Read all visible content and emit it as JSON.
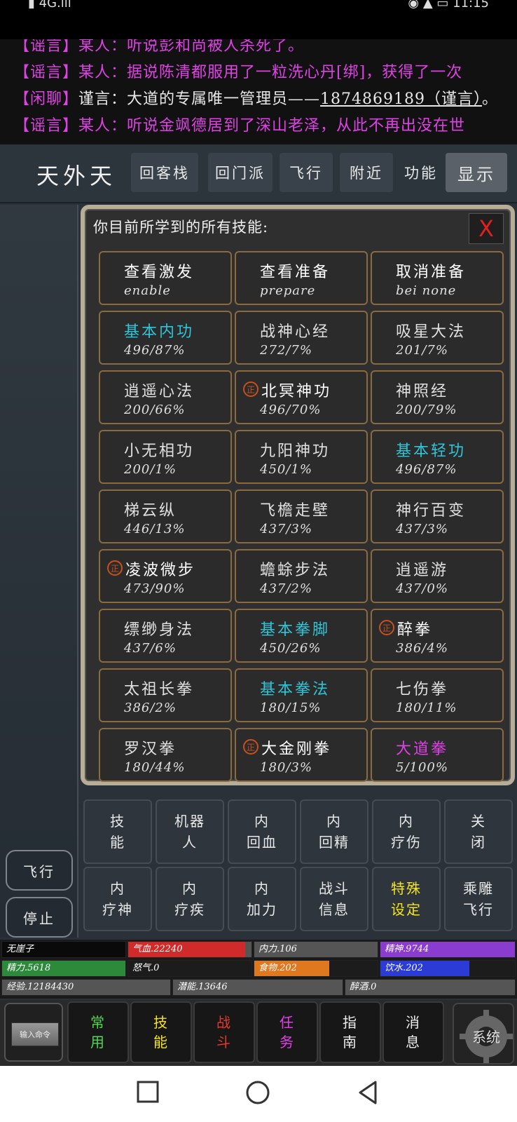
{
  "status_bar": {
    "left": "▮ 4G.ıll",
    "right": "◉ ▲ ▭ 11:15"
  },
  "chat": [
    {
      "tag": "【谣言】",
      "text": "某人：听说彭和尚被人杀死了。",
      "kind": "rumor"
    },
    {
      "tag": "【谣言】",
      "text": "某人：据说陈清都服用了一粒洗心丹[绑]，获得了一次",
      "kind": "rumor"
    },
    {
      "tag": "【闲聊】",
      "text": "谨言：大道的专属唯一管理员——",
      "link": "1874869189（谨言）",
      "end": "。",
      "kind": "chat"
    },
    {
      "tag": "【谣言】",
      "text": "某人：听说金飒德居到了深山老泽，从此不再出没在世",
      "kind": "rumor"
    }
  ],
  "location": {
    "title": "天外天",
    "buttons": [
      "回客栈",
      "回门派",
      "飞行",
      "附近",
      "功能",
      "显示"
    ]
  },
  "side_buttons": {
    "fly": "飞行",
    "stop": "停止"
  },
  "dialog": {
    "title": "你目前所学到的所有技能:",
    "close": "X",
    "cells": [
      {
        "name": "查看激发",
        "sub": "enable",
        "color": "white",
        "badge": ""
      },
      {
        "name": "查看准备",
        "sub": "prepare",
        "color": "white",
        "badge": ""
      },
      {
        "name": "取消准备",
        "sub": "bei none",
        "color": "white",
        "badge": ""
      },
      {
        "name": "基本内功",
        "sub": "496/87%",
        "color": "cyan",
        "badge": ""
      },
      {
        "name": "战神心经",
        "sub": "272/7%",
        "color": "default",
        "badge": ""
      },
      {
        "name": "吸星大法",
        "sub": "201/7%",
        "color": "default",
        "badge": ""
      },
      {
        "name": "逍遥心法",
        "sub": "200/66%",
        "color": "default",
        "badge": ""
      },
      {
        "name": "北冥神功",
        "sub": "496/70%",
        "color": "white",
        "badge": "正"
      },
      {
        "name": "神照经",
        "sub": "200/79%",
        "color": "default",
        "badge": ""
      },
      {
        "name": "小无相功",
        "sub": "200/1%",
        "color": "default",
        "badge": ""
      },
      {
        "name": "九阳神功",
        "sub": "450/1%",
        "color": "default",
        "badge": ""
      },
      {
        "name": "基本轻功",
        "sub": "496/87%",
        "color": "cyan",
        "badge": ""
      },
      {
        "name": "梯云纵",
        "sub": "446/13%",
        "color": "default",
        "badge": ""
      },
      {
        "name": "飞檐走壁",
        "sub": "437/3%",
        "color": "default",
        "badge": ""
      },
      {
        "name": "神行百变",
        "sub": "437/3%",
        "color": "default",
        "badge": ""
      },
      {
        "name": "凌波微步",
        "sub": "473/90%",
        "color": "white",
        "badge": "正"
      },
      {
        "name": "蟾蜍步法",
        "sub": "437/2%",
        "color": "default",
        "badge": ""
      },
      {
        "name": "逍遥游",
        "sub": "437/0%",
        "color": "default",
        "badge": ""
      },
      {
        "name": "缥缈身法",
        "sub": "437/6%",
        "color": "default",
        "badge": ""
      },
      {
        "name": "基本拳脚",
        "sub": "450/26%",
        "color": "cyan",
        "badge": ""
      },
      {
        "name": "醉拳",
        "sub": "386/4%",
        "color": "white",
        "badge": "正"
      },
      {
        "name": "太祖长拳",
        "sub": "386/2%",
        "color": "default",
        "badge": ""
      },
      {
        "name": "基本拳法",
        "sub": "180/15%",
        "color": "cyan",
        "badge": ""
      },
      {
        "name": "七伤拳",
        "sub": "180/11%",
        "color": "default",
        "badge": ""
      },
      {
        "name": "罗汉拳",
        "sub": "180/44%",
        "color": "default",
        "badge": ""
      },
      {
        "name": "大金刚拳",
        "sub": "180/3%",
        "color": "white",
        "badge": "正"
      },
      {
        "name": "大道拳",
        "sub": "5/100%",
        "color": "magenta",
        "badge": ""
      }
    ]
  },
  "actions": [
    {
      "l1": "技",
      "l2": "能",
      "special": false
    },
    {
      "l1": "机器",
      "l2": "人",
      "special": false
    },
    {
      "l1": "内",
      "l2": "回血",
      "special": false
    },
    {
      "l1": "内",
      "l2": "回精",
      "special": false
    },
    {
      "l1": "内",
      "l2": "疗伤",
      "special": false
    },
    {
      "l1": "关",
      "l2": "闭",
      "special": false
    },
    {
      "l1": "内",
      "l2": "疗神",
      "special": false
    },
    {
      "l1": "内",
      "l2": "疗疾",
      "special": false
    },
    {
      "l1": "内",
      "l2": "加力",
      "special": false
    },
    {
      "l1": "战斗",
      "l2": "信息",
      "special": false
    },
    {
      "l1": "特殊",
      "l2": "设定",
      "special": true
    },
    {
      "l1": "乘雕",
      "l2": "飞行",
      "special": false
    }
  ],
  "stats": {
    "name": "无崖子",
    "qixue": "气血.22240",
    "qixue_fill": 0.95,
    "neili": "内力.106",
    "jingshen": "精神.9744",
    "jingli": "精力.5618",
    "nuqi": "怒气.0",
    "shiwu": "食物.202",
    "shiwu_fill": 0.61,
    "yinshui": "饮水.202",
    "yinshui_fill": 0.66,
    "jingyan": "经验.12184430",
    "qianneng": "潜能.13646",
    "zuijiu": "醉酒.0",
    "colors": {
      "qixue": "#d02a2a",
      "jingshen": "#8a3bd0",
      "jingli": "#2c8a3a",
      "shiwu": "#e07820",
      "yinshui": "#2a3bd6"
    }
  },
  "bottom_nav": {
    "input": "输入命令",
    "items": [
      {
        "l1": "常",
        "l2": "用",
        "color": "green"
      },
      {
        "l1": "技",
        "l2": "能",
        "color": "yellow"
      },
      {
        "l1": "战",
        "l2": "斗",
        "color": "red"
      },
      {
        "l1": "任",
        "l2": "务",
        "color": "pink"
      },
      {
        "l1": "指",
        "l2": "南",
        "color": "white"
      },
      {
        "l1": "消",
        "l2": "息",
        "color": "white"
      }
    ],
    "gear": "系统"
  }
}
